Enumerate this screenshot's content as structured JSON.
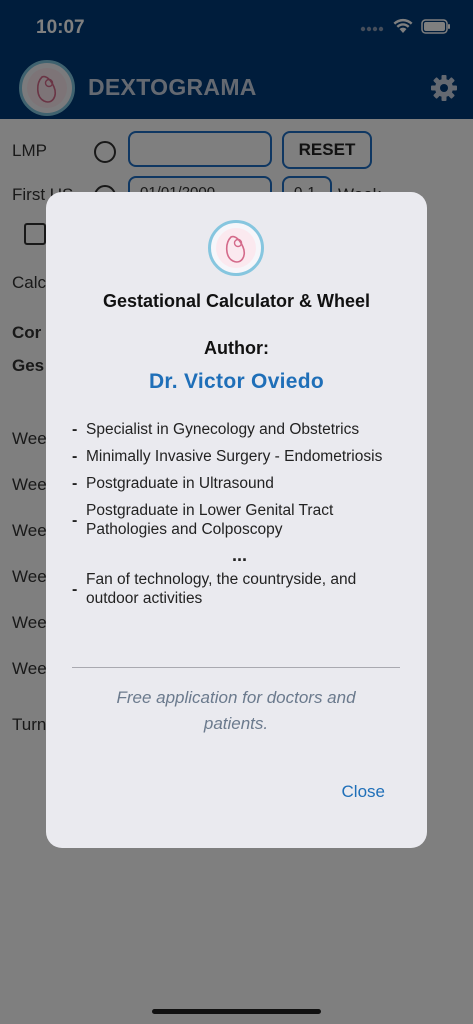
{
  "status": {
    "time": "10:07"
  },
  "app": {
    "title": "DEXTOGRAMA"
  },
  "form": {
    "lmp_label": "LMP",
    "reset_label": "RESET",
    "first_us_label": "First US",
    "first_us_date": "01/01/2000",
    "first_us_weeks": "0-1",
    "first_us_unit": "Week",
    "calc_label": "Calc",
    "cor_label": "Cor",
    "ges_label": "Ges",
    "week_labels": [
      "Wee",
      "Wee",
      "Wee",
      "Wee",
      "Wee",
      "Wee"
    ],
    "turn_label": "Turn"
  },
  "dialog": {
    "title": "Gestational Calculator & Wheel",
    "author_label": "Author:",
    "author_name": "Dr. Victor Oviedo",
    "bullets": [
      "Specialist in Gynecology and Obstetrics",
      "Minimally Invasive Surgery - Endometriosis",
      "Postgraduate in Ultrasound",
      "Postgraduate in Lower Genital Tract Pathologies and Colposcopy"
    ],
    "ellipsis": "...",
    "last_bullet": "Fan of technology, the countryside, and outdoor activities",
    "dash": "-",
    "note": "Free application for doctors and patients.",
    "close_label": "Close"
  },
  "colors": {
    "header": "#003a78",
    "accent": "#1f6fb8",
    "dialog_bg": "#eaeaef"
  }
}
